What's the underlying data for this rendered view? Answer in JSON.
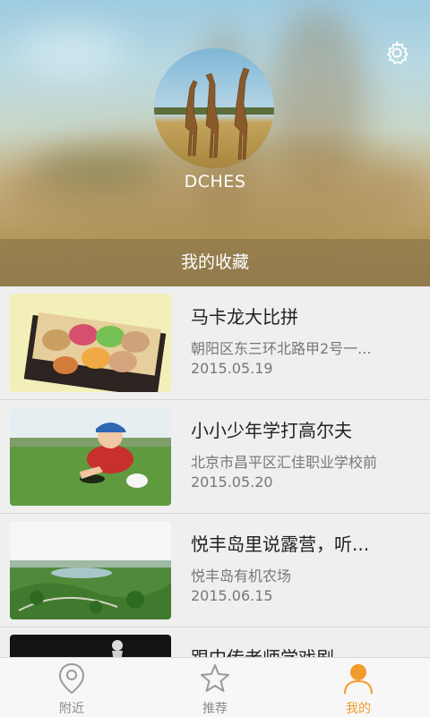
{
  "profile": {
    "username": "DCHES",
    "favorites_title": "我的收藏"
  },
  "favorites": [
    {
      "title": "马卡龙大比拼",
      "address": "朝阳区东三环北路甲2号一...",
      "date": "2015.05.19"
    },
    {
      "title": "小小少年学打高尔夫",
      "address": "北京市昌平区汇佳职业学校前",
      "date": "2015.05.20"
    },
    {
      "title": "悦丰岛里说露营，听...",
      "address": "悦丰岛有机农场",
      "date": "2015.06.15"
    },
    {
      "title": "跟中传老师学戏剧",
      "address": "",
      "date": ""
    }
  ],
  "tabs": [
    {
      "label": "附近",
      "icon": "location-pin-icon"
    },
    {
      "label": "推荐",
      "icon": "star-icon"
    },
    {
      "label": "我的",
      "icon": "person-icon"
    }
  ],
  "colors": {
    "accent": "#f39a2d",
    "inactive": "#8a8a8a"
  }
}
